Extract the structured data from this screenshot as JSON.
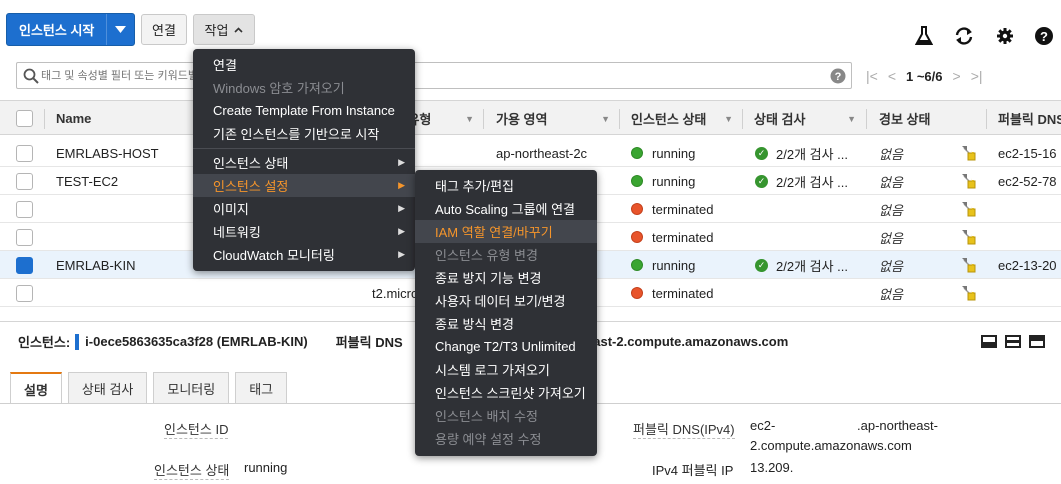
{
  "toolbar": {
    "launch_label": "인스턴스 시작",
    "connect_label": "연결",
    "actions_label": "작업"
  },
  "search": {
    "placeholder": "태그 및 속성별 필터 또는 키워드별 검색"
  },
  "pager": {
    "count": "1 ~6/6"
  },
  "table": {
    "headers": [
      "Name",
      "인스턴스 유형",
      "가용 영역",
      "인스턴스 상태",
      "상태 검사",
      "경보 상태",
      "퍼블릭 DNS"
    ],
    "rows": [
      {
        "name": "EMRLABS-HOST",
        "type": "",
        "az": "ap-northeast-2c",
        "state": "running",
        "state_color": "green",
        "check": "2/2개 검사 ...",
        "alarm": "없음",
        "dns": "ec2-15-16",
        "selected": false
      },
      {
        "name": "TEST-EC2",
        "type": "",
        "az": "",
        "state": "running",
        "state_color": "green",
        "check": "2/2개 검사 ...",
        "alarm": "없음",
        "dns": "ec2-52-78",
        "selected": false
      },
      {
        "name": "",
        "type": "",
        "az": "",
        "state": "terminated",
        "state_color": "red",
        "check": "",
        "alarm": "없음",
        "dns": "",
        "selected": false
      },
      {
        "name": "",
        "type": "",
        "az": "",
        "state": "terminated",
        "state_color": "red",
        "check": "",
        "alarm": "없음",
        "dns": "",
        "selected": false
      },
      {
        "name": "EMRLAB-KIN",
        "type": "",
        "az": "",
        "state": "running",
        "state_color": "green",
        "check": "2/2개 검사 ...",
        "alarm": "없음",
        "dns": "ec2-13-20",
        "selected": true
      },
      {
        "name": "",
        "type": "t2.micro",
        "az": "",
        "state": "terminated",
        "state_color": "red",
        "check": "",
        "alarm": "없음",
        "dns": "",
        "selected": false
      }
    ]
  },
  "detail": {
    "instance_label": "인스턴스:",
    "instance_id": "i-0ece5863635ca3f28 (EMRLAB-KIN)",
    "public_dns_label": "퍼블릭 DNS",
    "public_dns_tail": "rtheast-2.compute.amazonaws.com",
    "tabs": [
      "설명",
      "상태 검사",
      "모니터링",
      "태그"
    ],
    "fields": {
      "instance_id_label": "인스턴스 ID",
      "instance_state_label": "인스턴스 상태",
      "instance_state_value": "running",
      "public_dns_ipv4_label": "퍼블릭 DNS(IPv4)",
      "public_dns_ipv4_value_1": "ec2-",
      "public_dns_ipv4_value_2": ".ap-northeast-",
      "public_dns_ipv4_value_3": "2.compute.amazonaws.com",
      "ipv4_public_ip_label": "IPv4 퍼블릭 IP",
      "ipv4_public_ip_value": "13.209."
    }
  },
  "actions_menu": {
    "items": [
      "연결",
      "Windows 암호 가져오기",
      "Create Template From Instance",
      "기존 인스턴스를 기반으로 시작",
      "인스턴스 상태",
      "인스턴스 설정",
      "이미지",
      "네트워킹",
      "CloudWatch 모니터링"
    ]
  },
  "settings_menu": {
    "items": [
      "태그 추가/편집",
      "Auto Scaling 그룹에 연결",
      "IAM 역할 연결/바꾸기",
      "인스턴스 유형 변경",
      "종료 방지 기능 변경",
      "사용자 데이터 보기/변경",
      "종료 방식 변경",
      "Change T2/T3 Unlimited",
      "시스템 로그 가져오기",
      "인스턴스 스크린샷 가져오기",
      "인스턴스 배치 수정",
      "용량 예약 설정 수정"
    ]
  },
  "colors": {
    "accent": "#1d6fcf",
    "menu_bg": "#2f3136",
    "highlight_text": "#f5952b",
    "running": "#3aa531",
    "terminated": "#e8542b"
  }
}
